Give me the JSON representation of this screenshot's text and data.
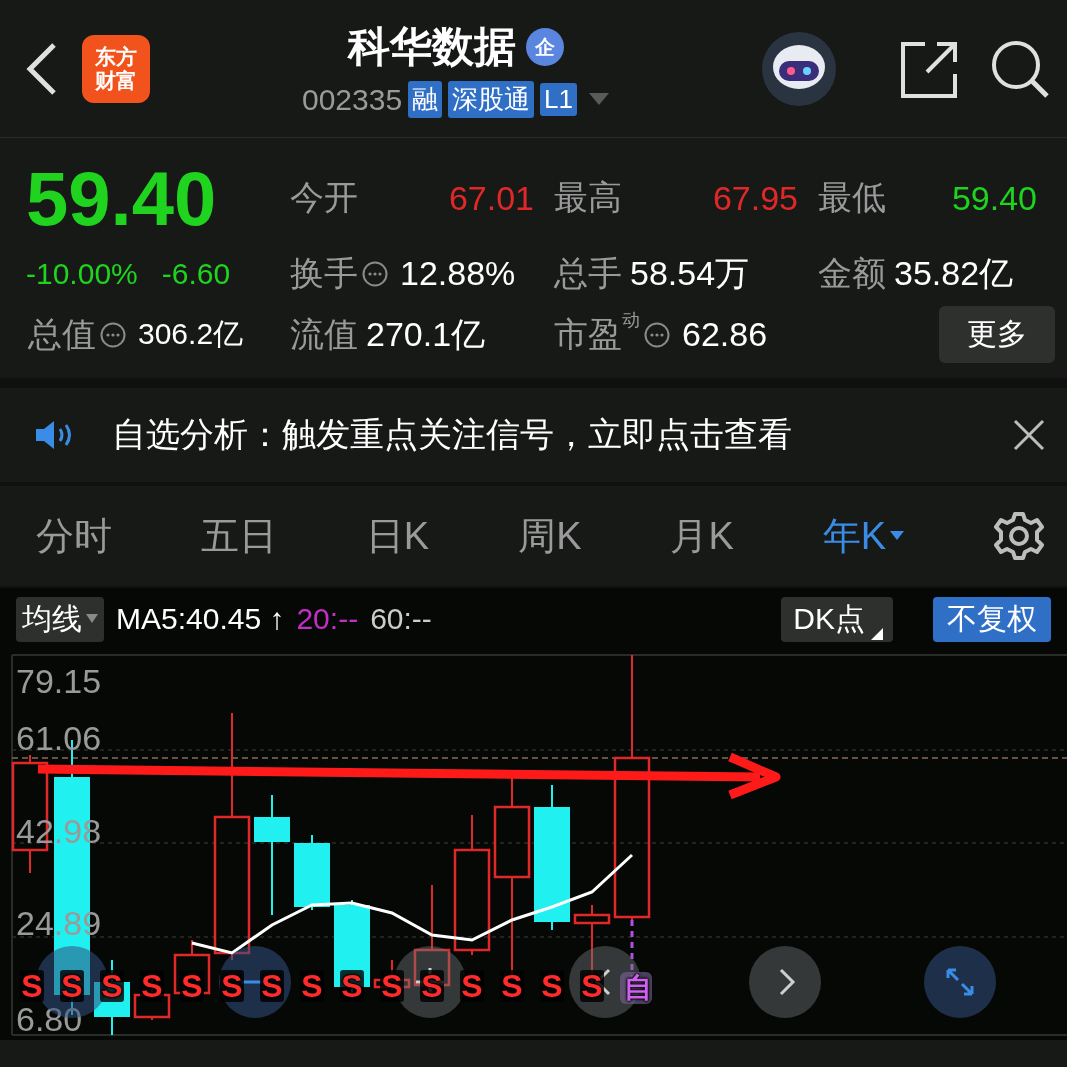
{
  "header": {
    "logo_lines": [
      "东方",
      "财富"
    ],
    "title": "科华数据",
    "title_badge": "企",
    "code": "002335",
    "tags": [
      "融",
      "深股通",
      "L1"
    ]
  },
  "quote": {
    "price": "59.40",
    "change_pct": "-10.00%",
    "change": "-6.60",
    "total_value": {
      "label": "总值",
      "value": "306.2亿",
      "info": true
    },
    "stats": [
      {
        "label": "今开",
        "value": "67.01",
        "color": "#e02828",
        "info": false
      },
      {
        "label": "最高",
        "value": "67.95",
        "color": "#e02828",
        "info": false
      },
      {
        "label": "最低",
        "value": "59.40",
        "color": "#1fd31f",
        "info": false
      },
      {
        "label": "换手",
        "value": "12.88%",
        "color": "#ffffff",
        "info": true
      },
      {
        "label": "总手",
        "value": "58.54万",
        "color": "#ffffff",
        "info": false
      },
      {
        "label": "金额",
        "value": "35.82亿",
        "color": "#ffffff",
        "info": false
      },
      {
        "label": "流值",
        "value": "270.1亿",
        "color": "#ffffff",
        "info": false
      },
      {
        "label": "市盈",
        "sup": "动",
        "value": "62.86",
        "color": "#ffffff",
        "info": true
      }
    ],
    "more_button": "更多"
  },
  "notice": {
    "text": "自选分析：触发重点关注信号，立即点击查看"
  },
  "periods": [
    {
      "label": "分时",
      "selected": false,
      "dropdown": false
    },
    {
      "label": "五日",
      "selected": false,
      "dropdown": false
    },
    {
      "label": "日K",
      "selected": false,
      "dropdown": false
    },
    {
      "label": "周K",
      "selected": false,
      "dropdown": false
    },
    {
      "label": "月K",
      "selected": false,
      "dropdown": false
    },
    {
      "label": "年K",
      "selected": true,
      "dropdown": true
    }
  ],
  "chart": {
    "indicator": "均线",
    "ma": [
      {
        "text": "MA5:40.45 ↑",
        "color": "#ffffff"
      },
      {
        "text": "20:--",
        "color": "#c32fc3"
      },
      {
        "text": "60:--",
        "color": "#cccccc"
      }
    ],
    "dk": "DK点",
    "adjust": "不复权",
    "y_labels": [
      "79.15",
      "61.06",
      "42.98",
      "24.89",
      "6.80"
    ],
    "markers": [
      {
        "text": "S",
        "kind": "sell"
      },
      {
        "text": "S",
        "kind": "sell"
      },
      {
        "text": "S",
        "kind": "sell"
      },
      {
        "text": "S",
        "kind": "sell"
      },
      {
        "text": "S",
        "kind": "sell"
      },
      {
        "text": "S",
        "kind": "sell"
      },
      {
        "text": "S",
        "kind": "sell"
      },
      {
        "text": "S",
        "kind": "sell"
      },
      {
        "text": "S",
        "kind": "sell"
      },
      {
        "text": "S",
        "kind": "sell"
      },
      {
        "text": "S",
        "kind": "sell"
      },
      {
        "text": "S",
        "kind": "sell"
      },
      {
        "text": "S",
        "kind": "sell"
      },
      {
        "text": "S",
        "kind": "sell"
      },
      {
        "text": "S",
        "kind": "sell"
      },
      {
        "text": "自",
        "kind": "self"
      }
    ]
  }
}
